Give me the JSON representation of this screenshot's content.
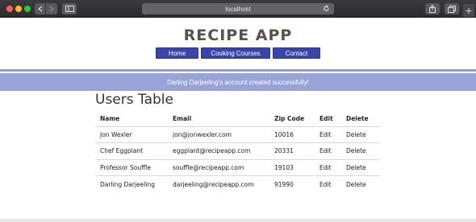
{
  "browser": {
    "address": "localhost"
  },
  "header": {
    "title": "RECIPE APP"
  },
  "nav": {
    "home": "Home",
    "courses": "Cooking Courses",
    "contact": "Contact"
  },
  "flash": {
    "message": "Darling Darjeeling's account created successfully!"
  },
  "users_table": {
    "title": "Users Table",
    "columns": [
      "Name",
      "Email",
      "Zip Code",
      "Edit",
      "Delete"
    ],
    "rows": [
      {
        "name": "Jon Wexler",
        "email": "jon@jonwexler.com",
        "zip": "10016",
        "edit": "Edit",
        "delete": "Delete"
      },
      {
        "name": "Chef Eggplant",
        "email": "eggplant@recipeapp.com",
        "zip": "20331",
        "edit": "Edit",
        "delete": "Delete"
      },
      {
        "name": "Professor Souffle",
        "email": "souffle@recipeapp.com",
        "zip": "19103",
        "edit": "Edit",
        "delete": "Delete"
      },
      {
        "name": "Darling Darjeeling",
        "email": "darjeeling@recipeapp.com",
        "zip": "91990",
        "edit": "Edit",
        "delete": "Delete"
      }
    ]
  },
  "colors": {
    "nav_button": "#3a45a8",
    "flash_bg": "#98a3d8",
    "title": "#5a524a"
  }
}
